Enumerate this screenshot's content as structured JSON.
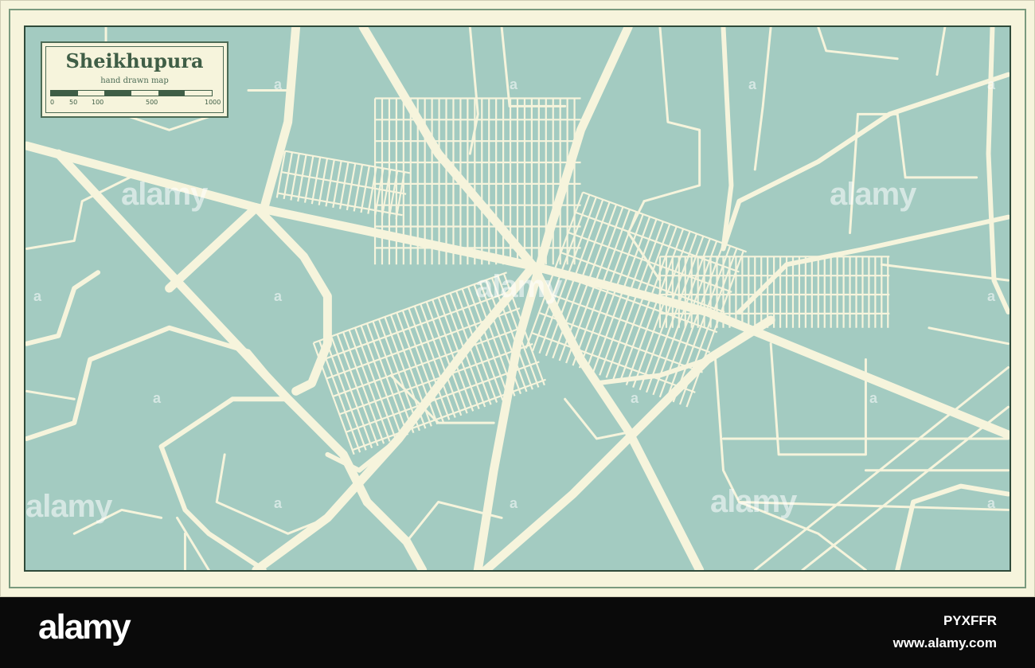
{
  "map": {
    "title": "Sheikhupura",
    "subtitle": "hand drawn map",
    "scale_labels": [
      "0",
      "50",
      "100",
      "500",
      "1000"
    ],
    "colors": {
      "land": "#a3cbc1",
      "roads": "#f6f4dc",
      "frame": "#f6f4dc",
      "accent": "#3f5e46"
    }
  },
  "watermark": {
    "text": "alamy",
    "small": "a"
  },
  "footer": {
    "logo": "alamy",
    "image_id": "PYXFFR",
    "url": "www.alamy.com"
  }
}
